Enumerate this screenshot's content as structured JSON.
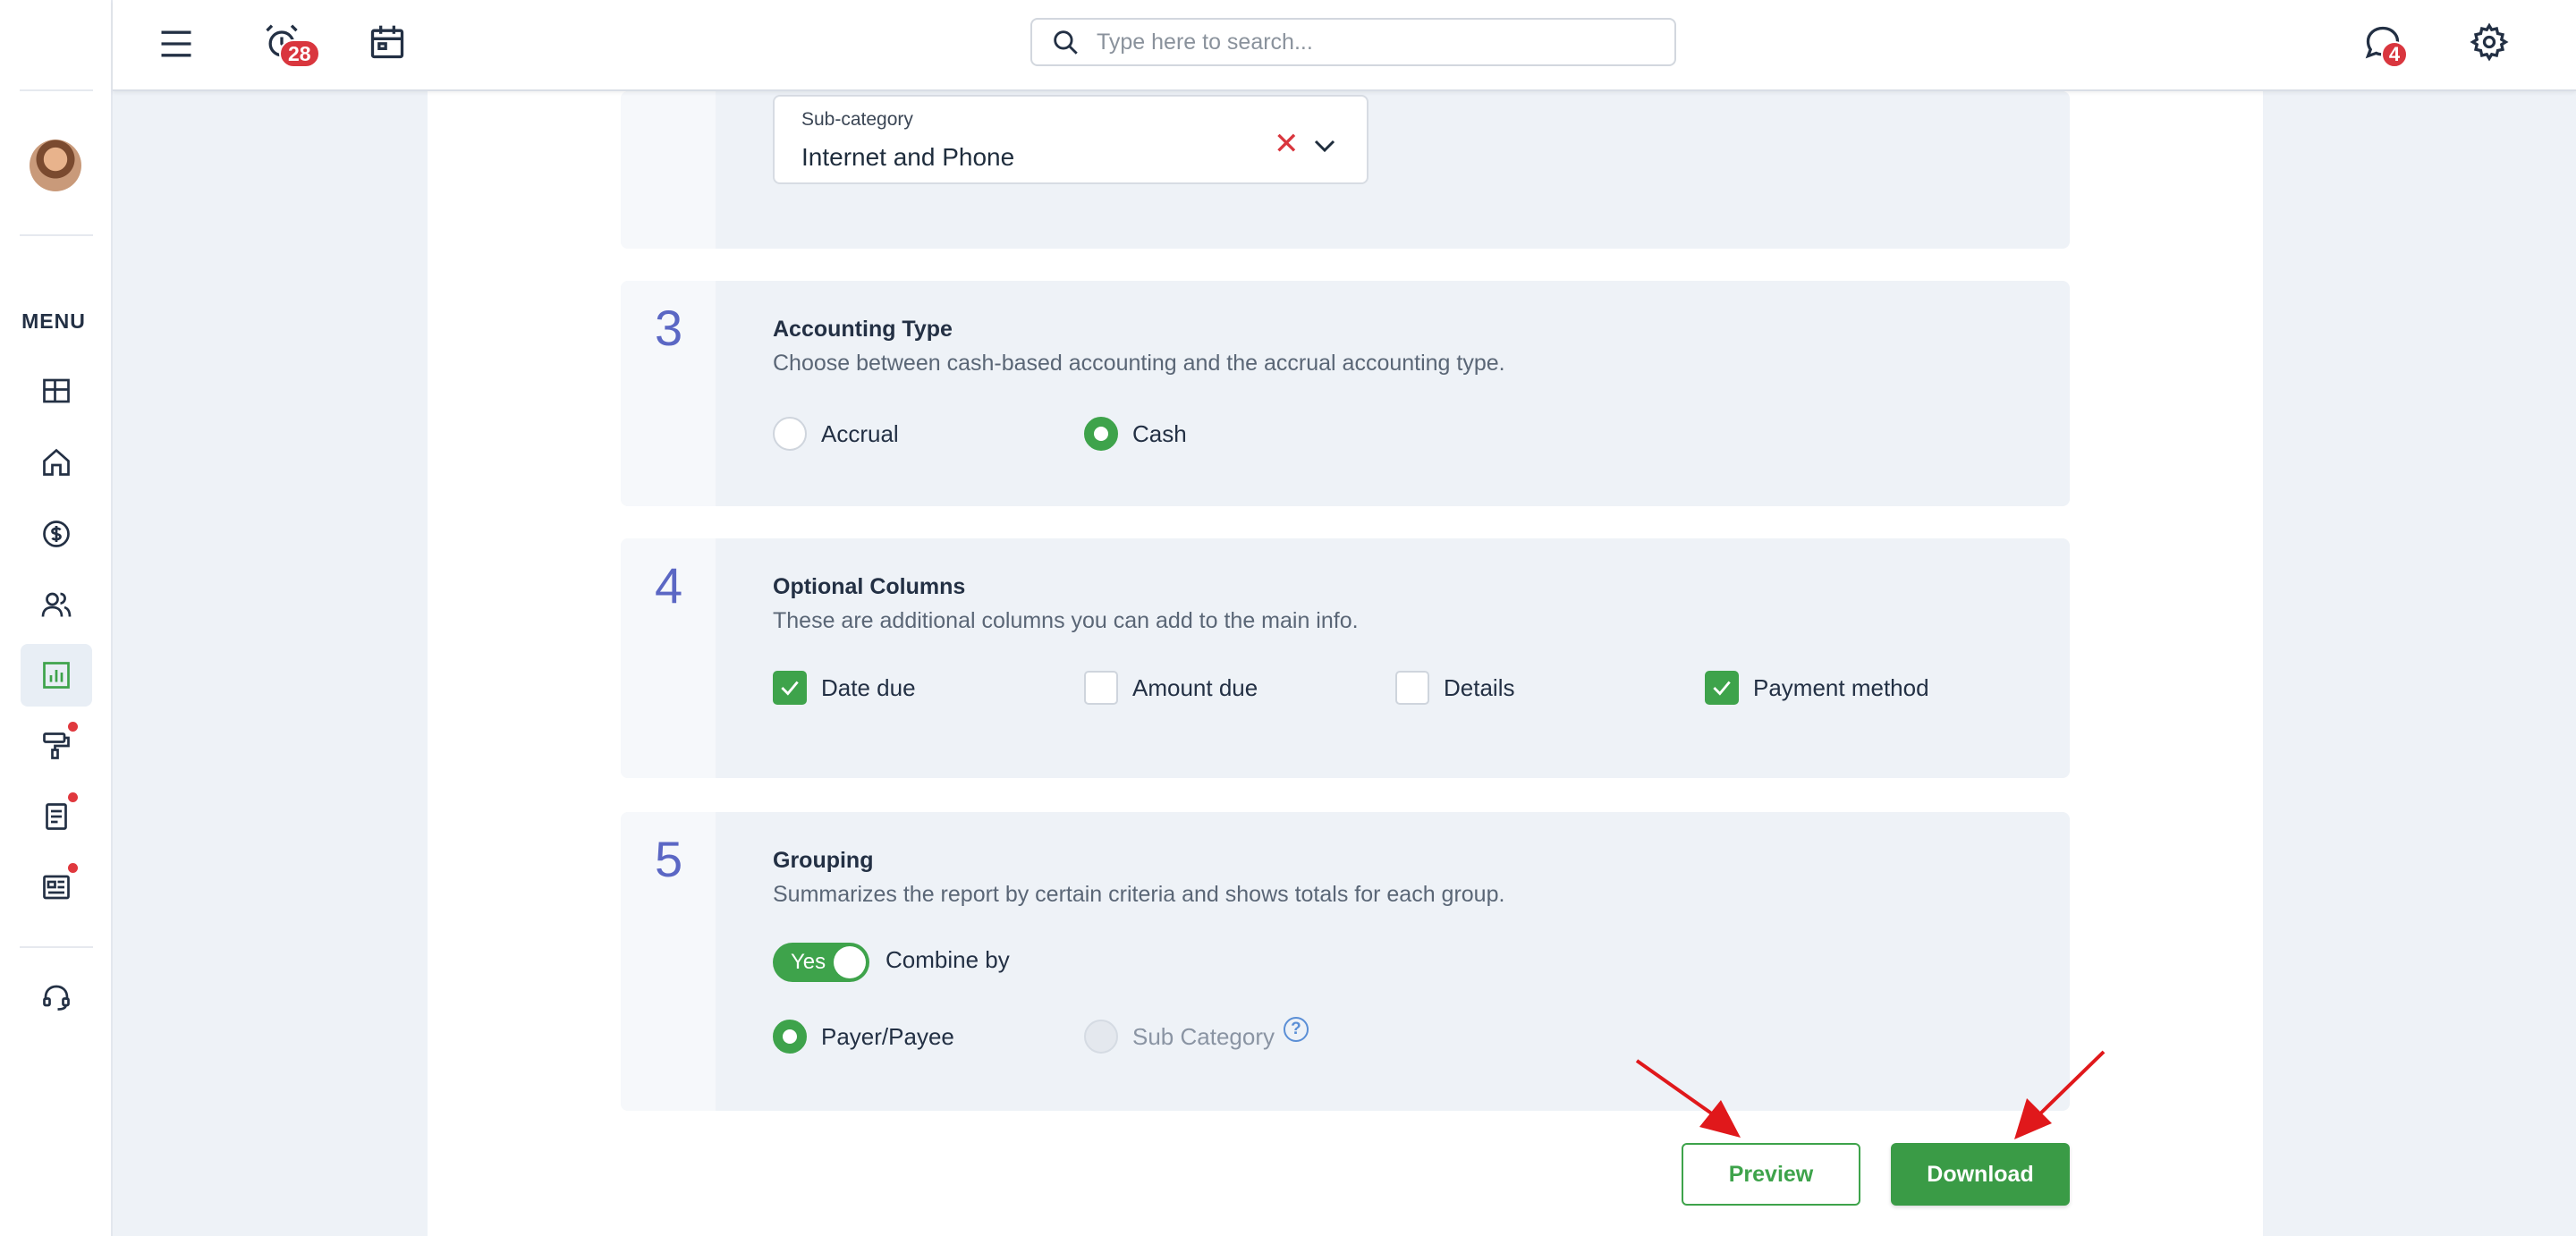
{
  "topbar": {
    "alarm_badge": "28",
    "messages_badge": "4",
    "search_placeholder": "Type here to search..."
  },
  "sidebar": {
    "menu_label": "MENU"
  },
  "subcategory": {
    "label": "Sub-category",
    "value": "Internet and Phone"
  },
  "section3": {
    "number": "3",
    "title": "Accounting Type",
    "description": "Choose between cash-based accounting and the accrual accounting type.",
    "options": [
      "Accrual",
      "Cash"
    ],
    "selected": "Cash"
  },
  "section4": {
    "number": "4",
    "title": "Optional Columns",
    "description": "These are additional columns you can add to the main info.",
    "options": [
      "Date due",
      "Amount due",
      "Details",
      "Payment method"
    ],
    "checked": [
      "Date due",
      "Payment method"
    ]
  },
  "section5": {
    "number": "5",
    "title": "Grouping",
    "description": "Summarizes the report by certain criteria and shows totals for each group.",
    "toggle_label": "Yes",
    "combine_label": "Combine by",
    "options": [
      "Payer/Payee",
      "Sub Category"
    ],
    "selected": "Payer/Payee",
    "help": "?"
  },
  "actions": {
    "preview": "Preview",
    "download": "Download"
  },
  "colors": {
    "accent_green": "#3ea34b",
    "number_blue": "#5b67c4",
    "badge_red": "#d9363e",
    "annotation_red": "#e0181b"
  }
}
